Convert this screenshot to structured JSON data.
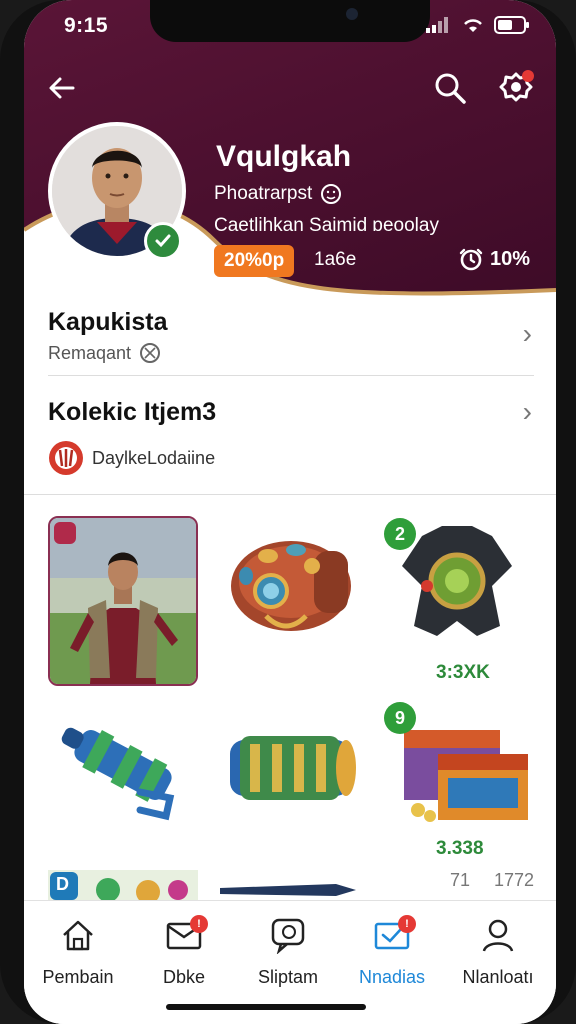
{
  "status_bar": {
    "time": "9:15"
  },
  "profile": {
    "name": "Vqulgkah",
    "subtitle": "Phoatrarpst",
    "description": "Caetlihkan Saimid ɒeoolay",
    "pill": "20%0p",
    "stat_text": "1a6e",
    "stat_right": "10%"
  },
  "sections": [
    {
      "title": "Kapukista",
      "subtitle": "Remaqant"
    },
    {
      "title": "Kolekic Itjem3",
      "subtitle": "DaylkeLodaiine"
    }
  ],
  "items": [
    {
      "badge": "",
      "price": ""
    },
    {
      "badge": "",
      "price": ""
    },
    {
      "badge": "2",
      "price": "3:3XK"
    },
    {
      "badge": "",
      "price": ""
    },
    {
      "badge": "",
      "price": ""
    },
    {
      "badge": "9",
      "price": "3.338"
    }
  ],
  "row3_labels": {
    "left": "71",
    "right": "1772"
  },
  "row3_badge": "D",
  "bottom_nav": [
    {
      "label": "Pembain",
      "icon": "home-icon",
      "badge": ""
    },
    {
      "label": "Dbke",
      "icon": "mail-icon",
      "badge": "!"
    },
    {
      "label": "Sliptam",
      "icon": "chat-icon",
      "badge": ""
    },
    {
      "label": "Nnadias",
      "icon": "inbox-icon",
      "badge": "!"
    },
    {
      "label": "Nlanloatı",
      "icon": "user-icon",
      "badge": ""
    }
  ],
  "colors": {
    "header": "#4a0f2e",
    "accent": "#f07820",
    "green": "#2e8b3d",
    "active": "#1e88d8"
  }
}
